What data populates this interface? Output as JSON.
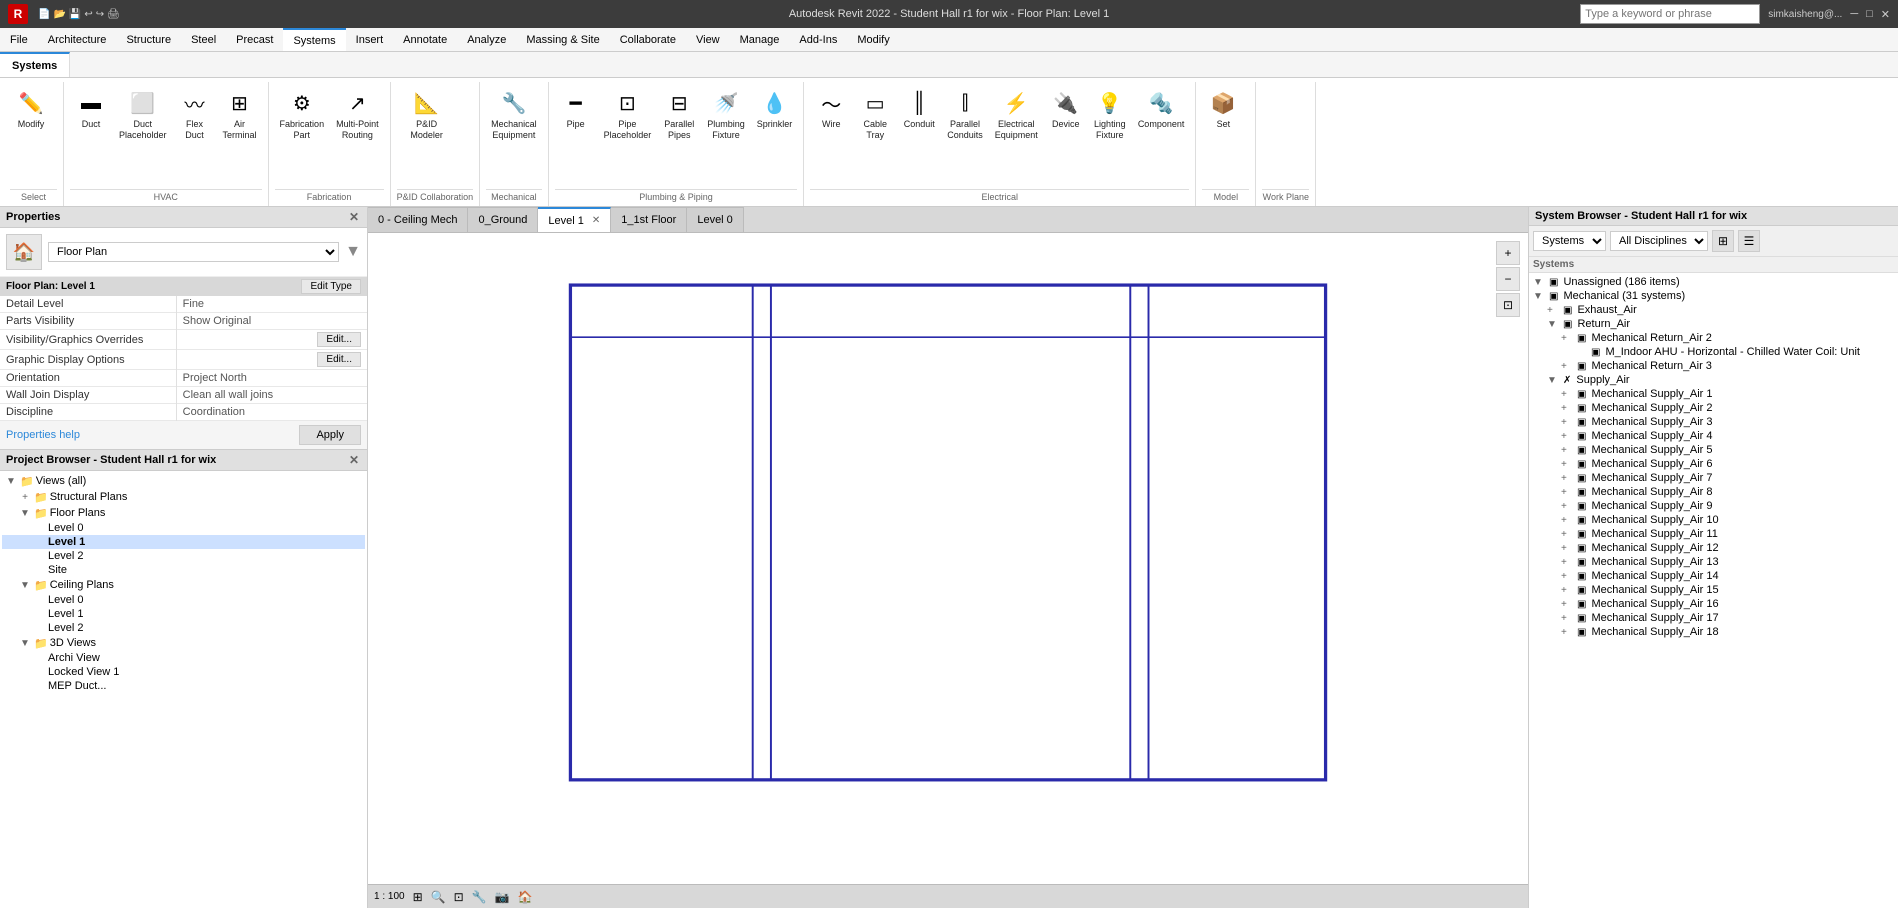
{
  "titleBar": {
    "title": "Autodesk Revit 2022 - Student Hall r1 for wix - Floor Plan: Level 1",
    "searchPlaceholder": "Type a keyword or phrase",
    "userLabel": "simkaisheng@...",
    "logoText": "R"
  },
  "menuBar": {
    "items": [
      "File",
      "Architecture",
      "Structure",
      "Steel",
      "Precast",
      "Systems",
      "Insert",
      "Annotate",
      "Analyze",
      "Massing & Site",
      "Collaborate",
      "View",
      "Manage",
      "Add-Ins",
      "Modify"
    ],
    "activeIndex": 5
  },
  "ribbon": {
    "tabs": [
      "Systems"
    ],
    "groups": [
      {
        "label": "Select",
        "items": [
          {
            "id": "modify",
            "label": "Modify",
            "icon": "✏️"
          }
        ]
      },
      {
        "label": "HVAC",
        "items": [
          {
            "id": "duct",
            "label": "Duct",
            "icon": "▬"
          },
          {
            "id": "duct-placeholder",
            "label": "Duct\nPlaceholder",
            "icon": "⬜"
          },
          {
            "id": "flex-duct",
            "label": "Flex\nDuct",
            "icon": "〰"
          },
          {
            "id": "air-terminal",
            "label": "Air\nTerminal",
            "icon": "⊞"
          }
        ]
      },
      {
        "label": "Fabrication",
        "items": [
          {
            "id": "fabrication-part",
            "label": "Fabrication\nPart",
            "icon": "⚙"
          },
          {
            "id": "multi-point-routing",
            "label": "Multi-Point\nRouting",
            "icon": "↗"
          }
        ]
      },
      {
        "label": "P&ID Collaboration",
        "items": [
          {
            "id": "pid-modeler",
            "label": "P&ID Modeler",
            "icon": "📐"
          }
        ]
      },
      {
        "label": "Mechanical",
        "items": [
          {
            "id": "mechanical-equipment",
            "label": "Mechanical\nEquipment",
            "icon": "🔧"
          }
        ]
      },
      {
        "label": "Plumbing & Piping",
        "items": [
          {
            "id": "pipe",
            "label": "Pipe",
            "icon": "━"
          },
          {
            "id": "pipe-placeholder",
            "label": "Pipe\nPlaceholder",
            "icon": "⊡"
          },
          {
            "id": "parallel-pipes",
            "label": "Parallel\nPipes",
            "icon": "⊟"
          },
          {
            "id": "plumbing-fixture",
            "label": "Plumbing\nFixture",
            "icon": "🚿"
          },
          {
            "id": "sprinkler",
            "label": "Sprinkler",
            "icon": "💧"
          }
        ]
      },
      {
        "label": "Electrical",
        "items": [
          {
            "id": "wire",
            "label": "Wire",
            "icon": "〜"
          },
          {
            "id": "cable-tray",
            "label": "Cable\nTray",
            "icon": "▭"
          },
          {
            "id": "conduit",
            "label": "Conduit",
            "icon": "║"
          },
          {
            "id": "parallel-conduits",
            "label": "Parallel\nConduits",
            "icon": "⫿"
          },
          {
            "id": "electrical-equipment",
            "label": "Electrical\nEquipment",
            "icon": "⚡"
          },
          {
            "id": "device",
            "label": "Device",
            "icon": "🔌"
          },
          {
            "id": "lighting-fixture",
            "label": "Lighting\nFixture",
            "icon": "💡"
          },
          {
            "id": "component",
            "label": "Component",
            "icon": "🔩"
          }
        ]
      },
      {
        "label": "Model",
        "items": [
          {
            "id": "set",
            "label": "Set",
            "icon": "📦"
          }
        ]
      },
      {
        "label": "Work Plane",
        "items": []
      }
    ]
  },
  "properties": {
    "title": "Properties",
    "typeLabel": "Floor Plan",
    "instanceLabel": "Floor Plan: Level 1",
    "editTypeLabel": "Edit Type",
    "rows": [
      {
        "label": "Detail Level",
        "value": "Fine"
      },
      {
        "label": "Parts Visibility",
        "value": "Show Original"
      },
      {
        "label": "Visibility/Graphics Overrides",
        "value": "Edit...",
        "isButton": true
      },
      {
        "label": "Graphic Display Options",
        "value": "Edit...",
        "isButton": true
      },
      {
        "label": "Orientation",
        "value": "Project North"
      },
      {
        "label": "Wall Join Display",
        "value": "Clean all wall joins"
      },
      {
        "label": "Discipline",
        "value": "Coordination"
      }
    ],
    "propertiesHelpLabel": "Properties help",
    "applyLabel": "Apply"
  },
  "projectBrowser": {
    "title": "Project Browser - Student Hall r1 for wix",
    "tree": [
      {
        "indent": 0,
        "expand": "▼",
        "icon": "📁",
        "label": "Views (all)"
      },
      {
        "indent": 1,
        "expand": "+",
        "icon": "📁",
        "label": "Structural Plans"
      },
      {
        "indent": 1,
        "expand": "▼",
        "icon": "📁",
        "label": "Floor Plans"
      },
      {
        "indent": 2,
        "expand": "",
        "icon": "",
        "label": "Level 0"
      },
      {
        "indent": 2,
        "expand": "",
        "icon": "",
        "label": "Level 1",
        "bold": true
      },
      {
        "indent": 2,
        "expand": "",
        "icon": "",
        "label": "Level 2"
      },
      {
        "indent": 2,
        "expand": "",
        "icon": "",
        "label": "Site"
      },
      {
        "indent": 1,
        "expand": "▼",
        "icon": "📁",
        "label": "Ceiling Plans"
      },
      {
        "indent": 2,
        "expand": "",
        "icon": "",
        "label": "Level 0"
      },
      {
        "indent": 2,
        "expand": "",
        "icon": "",
        "label": "Level 1"
      },
      {
        "indent": 2,
        "expand": "",
        "icon": "",
        "label": "Level 2"
      },
      {
        "indent": 1,
        "expand": "▼",
        "icon": "📁",
        "label": "3D Views"
      },
      {
        "indent": 2,
        "expand": "",
        "icon": "",
        "label": "Archi View"
      },
      {
        "indent": 2,
        "expand": "",
        "icon": "",
        "label": "Locked View 1"
      },
      {
        "indent": 2,
        "expand": "",
        "icon": "",
        "label": "MEP Duct..."
      }
    ]
  },
  "viewTabs": [
    {
      "label": "0 - Ceiling Mech",
      "active": false,
      "closeable": false
    },
    {
      "label": "0_Ground",
      "active": false,
      "closeable": false
    },
    {
      "label": "Level 1",
      "active": true,
      "closeable": true
    },
    {
      "label": "1_1st Floor",
      "active": false,
      "closeable": false
    },
    {
      "label": "Level 0",
      "active": false,
      "closeable": false
    }
  ],
  "canvasFooter": {
    "scale": "1 : 100"
  },
  "systemBrowser": {
    "title": "System Browser - Student Hall r1 for wix",
    "systemsLabel": "Systems",
    "allDisciplinesLabel": "All Disciplines",
    "sectionLabel": "Systems",
    "items": [
      {
        "indent": 0,
        "expand": "▼",
        "icon": "🔲",
        "label": "Unassigned (186 items)"
      },
      {
        "indent": 0,
        "expand": "▼",
        "icon": "🔲",
        "label": "Mechanical (31 systems)"
      },
      {
        "indent": 1,
        "expand": "+",
        "icon": "🔲",
        "label": "Exhaust_Air"
      },
      {
        "indent": 1,
        "expand": "▼",
        "icon": "🔲",
        "label": "Return_Air"
      },
      {
        "indent": 2,
        "expand": "+",
        "icon": "🔲",
        "label": "Mechanical Return_Air 2"
      },
      {
        "indent": 3,
        "expand": "",
        "icon": "🔲",
        "label": "M_Indoor AHU - Horizontal - Chilled Water Coil: Unit"
      },
      {
        "indent": 2,
        "expand": "+",
        "icon": "🔲",
        "label": "Mechanical Return_Air 3"
      },
      {
        "indent": 1,
        "expand": "▼",
        "icon": "✖",
        "label": "Supply_Air"
      },
      {
        "indent": 2,
        "expand": "+",
        "icon": "🔲",
        "label": "Mechanical Supply_Air 1"
      },
      {
        "indent": 2,
        "expand": "+",
        "icon": "🔲",
        "label": "Mechanical Supply_Air 2"
      },
      {
        "indent": 2,
        "expand": "+",
        "icon": "🔲",
        "label": "Mechanical Supply_Air 3"
      },
      {
        "indent": 2,
        "expand": "+",
        "icon": "🔲",
        "label": "Mechanical Supply_Air 4"
      },
      {
        "indent": 2,
        "expand": "+",
        "icon": "🔲",
        "label": "Mechanical Supply_Air 5"
      },
      {
        "indent": 2,
        "expand": "+",
        "icon": "🔲",
        "label": "Mechanical Supply_Air 6"
      },
      {
        "indent": 2,
        "expand": "+",
        "icon": "🔲",
        "label": "Mechanical Supply_Air 7"
      },
      {
        "indent": 2,
        "expand": "+",
        "icon": "🔲",
        "label": "Mechanical Supply_Air 8"
      },
      {
        "indent": 2,
        "expand": "+",
        "icon": "🔲",
        "label": "Mechanical Supply_Air 9"
      },
      {
        "indent": 2,
        "expand": "+",
        "icon": "🔲",
        "label": "Mechanical Supply_Air 10"
      },
      {
        "indent": 2,
        "expand": "+",
        "icon": "🔲",
        "label": "Mechanical Supply_Air 11"
      },
      {
        "indent": 2,
        "expand": "+",
        "icon": "🔲",
        "label": "Mechanical Supply_Air 12"
      },
      {
        "indent": 2,
        "expand": "+",
        "icon": "🔲",
        "label": "Mechanical Supply_Air 13"
      },
      {
        "indent": 2,
        "expand": "+",
        "icon": "🔲",
        "label": "Mechanical Supply_Air 14"
      },
      {
        "indent": 2,
        "expand": "+",
        "icon": "🔲",
        "label": "Mechanical Supply_Air 15"
      },
      {
        "indent": 2,
        "expand": "+",
        "icon": "🔲",
        "label": "Mechanical Supply_Air 16"
      },
      {
        "indent": 2,
        "expand": "+",
        "icon": "🔲",
        "label": "Mechanical Supply_Air 17"
      },
      {
        "indent": 2,
        "expand": "+",
        "icon": "🔲",
        "label": "Mechanical Supply_Air 18"
      }
    ]
  }
}
